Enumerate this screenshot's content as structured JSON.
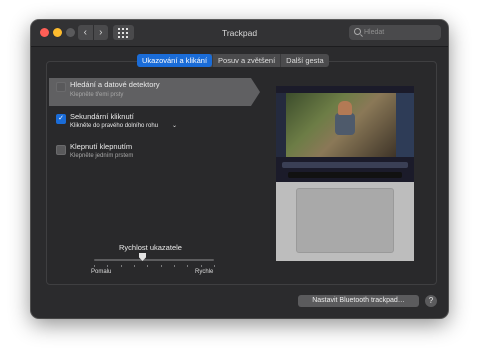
{
  "window": {
    "title": "Trackpad"
  },
  "toolbar": {
    "back_icon": "chevron-left-icon",
    "forward_icon": "chevron-right-icon",
    "show_all_icon": "grid-icon",
    "search_placeholder": "Hledat"
  },
  "tabs": [
    {
      "label": "Ukazování a klikání",
      "active": true
    },
    {
      "label": "Posuv a zvětšení",
      "active": false
    },
    {
      "label": "Další gesta",
      "active": false
    }
  ],
  "options": [
    {
      "title": "Hledání a datové detektory",
      "subtitle": "Klepněte třemi prsty",
      "checked": false,
      "selected": true
    },
    {
      "title": "Sekundární kliknutí",
      "subtitle": "Klikněte do pravého dolního rohu",
      "checked": true,
      "selected": false
    },
    {
      "title": "Klepnutí klepnutím",
      "subtitle": "Klepněte jedním prstem",
      "checked": false,
      "selected": false
    }
  ],
  "slider": {
    "label": "Rychlost ukazatele",
    "min_label": "Pomalu",
    "max_label": "Rychle",
    "value_fraction": 0.4
  },
  "footer": {
    "bluetooth_button": "Nastavit Bluetooth trackpad…",
    "help_label": "?"
  },
  "colors": {
    "accent": "#1a6cd8",
    "window_bg": "#2b2b2d"
  }
}
